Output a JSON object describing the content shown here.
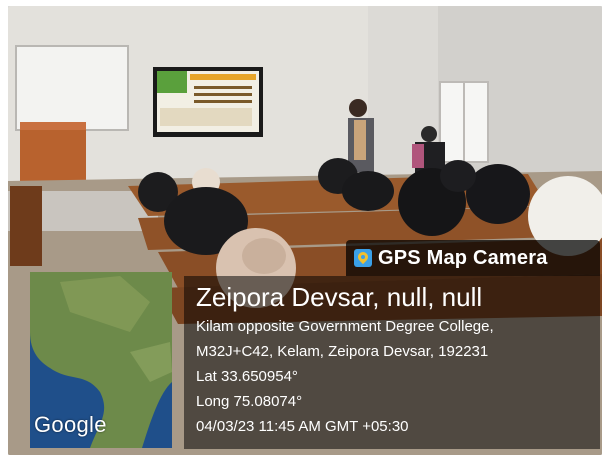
{
  "overlay": {
    "app_name": "GPS Map Camera",
    "place": "Zeipora Devsar, null, null",
    "address_line1": "Kilam opposite Government Degree College,",
    "address_line2": "M32J+C42, Kelam, Zeipora Devsar, 192231",
    "lat": "Lat 33.650954°",
    "long": "Long 75.08074°",
    "datetime": "04/03/23 11:45 AM GMT +05:30",
    "map_brand": "Google"
  },
  "colors": {
    "map_water": "#1f4f8a",
    "map_land": "#6d8a4a",
    "badge_bg": "#000000"
  }
}
